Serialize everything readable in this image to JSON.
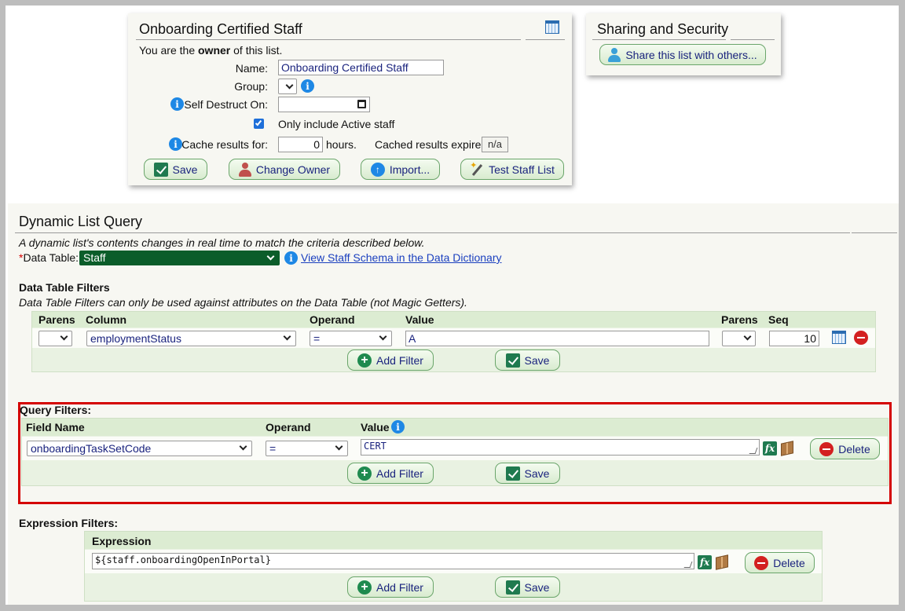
{
  "colors": {
    "accent_green": "#1f7a4f",
    "datatable_select_bg": "#0b5d2a",
    "highlight_red": "#d40000",
    "panel_band": "#dcecd2"
  },
  "owner_card": {
    "title": "Onboarding Certified Staff",
    "owner_prefix": "You are the",
    "owner_word": "owner",
    "owner_suffix": "of this list.",
    "name_label": "Name:",
    "name_value": "Onboarding Certified Staff",
    "group_label": "Group:",
    "self_destruct_label": "Self Destruct On:",
    "active_only_label": "Only include Active staff",
    "active_only_checked": true,
    "cache_label": "Cache results for:",
    "cache_value": "0",
    "cache_unit": "hours.",
    "cache_expire_label": "Cached results expire:",
    "cache_expire_value": "n/a",
    "buttons": {
      "save": "Save",
      "change_owner": "Change Owner",
      "import": "Import...",
      "test": "Test Staff List"
    },
    "icons": [
      "calendar-icon"
    ]
  },
  "sharing_card": {
    "title": "Sharing and Security",
    "share_button": "Share this list with others..."
  },
  "dynamic_query": {
    "title": "Dynamic List Query",
    "description": "A dynamic list's contents changes in real time to match the criteria described below.",
    "required_mark": "*",
    "data_table_label": "Data Table:",
    "data_table_value": "Staff",
    "schema_link": "View Staff Schema in the Data Dictionary"
  },
  "data_table_filters": {
    "title": "Data Table Filters",
    "note": "Data Table Filters can only be used against attributes on the Data Table (not Magic Getters).",
    "headers": {
      "parens_open": "Parens",
      "column": "Column",
      "operand": "Operand",
      "value": "Value",
      "parens_close": "Parens",
      "seq": "Seq"
    },
    "rows": [
      {
        "parens_open": "",
        "column": "employmentStatus",
        "operand": "=",
        "value": "A",
        "parens_close": "",
        "seq": "10"
      }
    ],
    "add_filter": "Add Filter",
    "save": "Save"
  },
  "query_filters": {
    "title": "Query Filters:",
    "headers": {
      "field_name": "Field Name",
      "operand": "Operand",
      "value": "Value"
    },
    "rows": [
      {
        "field_name": "onboardingTaskSetCode",
        "operand": "=",
        "value": "CERT",
        "delete": "Delete"
      }
    ],
    "add_filter": "Add Filter",
    "save": "Save"
  },
  "expression_filters": {
    "title": "Expression Filters:",
    "headers": {
      "expression": "Expression"
    },
    "rows": [
      {
        "expression": "${staff.onboardingOpenInPortal}",
        "delete": "Delete"
      }
    ],
    "add_filter": "Add Filter",
    "save": "Save"
  }
}
